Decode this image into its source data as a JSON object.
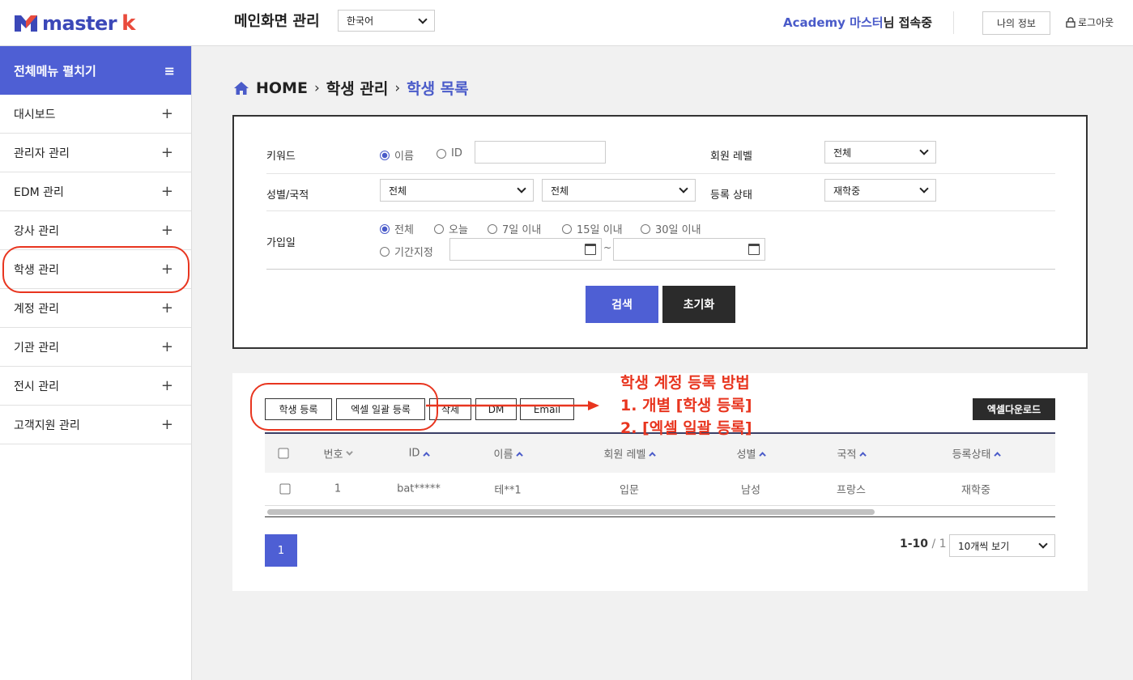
{
  "header": {
    "logo_text": "master",
    "logo_k": "k",
    "page_title": "메인화면 관리",
    "language": "한국어",
    "user_name": "Academy 마스터",
    "user_suffix": "님 접속중",
    "myinfo": "나의 정보",
    "logout": "로그아웃"
  },
  "sidebar": {
    "toggle_label": "전체메뉴 펼치기",
    "items": [
      {
        "label": "대시보드"
      },
      {
        "label": "관리자 관리"
      },
      {
        "label": "EDM 관리"
      },
      {
        "label": "강사 관리"
      },
      {
        "label": "학생 관리"
      },
      {
        "label": "계정 관리"
      },
      {
        "label": "기관 관리"
      },
      {
        "label": "전시 관리"
      },
      {
        "label": "고객지원 관리"
      }
    ]
  },
  "breadcrumb": {
    "home": "HOME",
    "level1": "학생 관리",
    "current": "학생 목록"
  },
  "search": {
    "keyword_label": "키워드",
    "keyword_opt1": "이름",
    "keyword_opt2": "ID",
    "level_label": "회원 레벨",
    "level_value": "전체",
    "gender_label": "성별/국적",
    "gender_value": "전체",
    "nation_value": "전체",
    "status_label": "등록 상태",
    "status_value": "재학중",
    "join_label": "가입일",
    "join_opts": [
      "전체",
      "오늘",
      "7일 이내",
      "15일 이내",
      "30일 이내"
    ],
    "join_period": "기간지정",
    "tilde": "~",
    "search_btn": "검색",
    "reset_btn": "초기화"
  },
  "list": {
    "btn_register": "학생 등록",
    "btn_bulk": "엑셀 일괄 등록",
    "btn_delete": "삭제",
    "btn_dm": "DM",
    "btn_email": "Email",
    "btn_excel": "엑셀다운로드",
    "columns": [
      "번호",
      "ID",
      "이름",
      "회원 레벨",
      "성별",
      "국적",
      "등록상태"
    ],
    "rows": [
      {
        "no": "1",
        "id": "bat*****",
        "name": "테**1",
        "level": "입문",
        "gender": "남성",
        "nation": "프랑스",
        "status": "재학중"
      }
    ],
    "page": "1",
    "range": "1-10",
    "total": "/ 1",
    "per_page": "10개씩 보기"
  },
  "annotation": {
    "line1": "학생 계정 등록 방법",
    "line2": "1. 개별 [학생 등록]",
    "line3": "2. [엑셀 일괄 등록]"
  },
  "colors": {
    "accent": "#4e5fd4",
    "annotation": "#e8351f",
    "dark": "#2b2b2b"
  }
}
